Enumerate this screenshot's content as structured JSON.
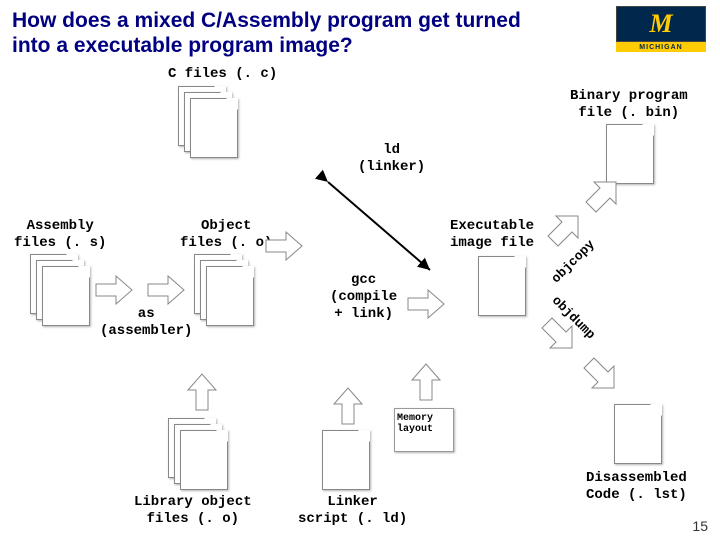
{
  "title": "How does a mixed C/Assembly program get turned into a executable program image?",
  "labels": {
    "c_files": "C files (. c)",
    "assembly_files": "Assembly\nfiles (. s)",
    "object_files": "Object\nfiles (. o)",
    "assembler": "as\n(assembler)",
    "gcc": "gcc\n(compile\n+ link)",
    "linker": "ld\n(linker)",
    "executable": "Executable\nimage file",
    "binary": "Binary program\nfile (. bin)",
    "objcopy": "objcopy",
    "objdump": "objdump",
    "memory_layout": "Memory\nlayout",
    "library": "Library object\nfiles (. o)",
    "linker_script": "Linker\nscript (. ld)",
    "disassembled": "Disassembled\nCode (. lst)"
  },
  "logo": {
    "text": "M",
    "band": "MICHIGAN"
  },
  "slide": "15"
}
